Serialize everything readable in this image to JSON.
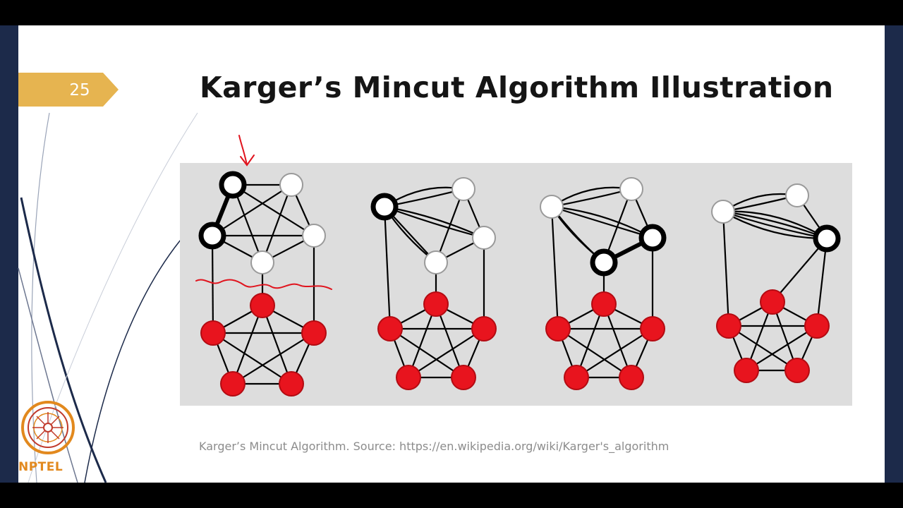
{
  "slide": {
    "number": "25",
    "title": "Karger’s Mincut Algorithm Illustration",
    "caption": "Karger’s Mincut Algorithm. Source: https://en.wikipedia.org/wiki/Karger's_algorithm"
  },
  "logo": {
    "text": "NPTEL"
  },
  "colors": {
    "frame": "#000000",
    "slide_border": "#1c2a4a",
    "slide_bg": "#ffffff",
    "number_tab": "#e6b450",
    "figure_bg": "#dddddd",
    "red_node": "#e8141e",
    "white_node": "#ffffff",
    "black_node": "#000000",
    "annotation": "#e0141e"
  },
  "diagram": {
    "panels": [
      {
        "name": "step-1",
        "nodes": [
          {
            "id": "a",
            "kind": "black"
          },
          {
            "id": "b",
            "kind": "white"
          },
          {
            "id": "c",
            "kind": "black"
          },
          {
            "id": "d",
            "kind": "white"
          },
          {
            "id": "e",
            "kind": "white"
          },
          {
            "id": "r1",
            "kind": "red"
          },
          {
            "id": "r2",
            "kind": "red"
          },
          {
            "id": "r3",
            "kind": "red"
          },
          {
            "id": "r4",
            "kind": "red"
          },
          {
            "id": "r5",
            "kind": "red"
          }
        ],
        "contract_edge": [
          "a",
          "c"
        ]
      },
      {
        "name": "step-2",
        "nodes": [
          {
            "id": "a",
            "kind": "black"
          },
          {
            "id": "b",
            "kind": "white"
          },
          {
            "id": "d",
            "kind": "white"
          },
          {
            "id": "e",
            "kind": "white"
          },
          {
            "id": "r1",
            "kind": "red"
          },
          {
            "id": "r2",
            "kind": "red"
          },
          {
            "id": "r3",
            "kind": "red"
          },
          {
            "id": "r4",
            "kind": "red"
          },
          {
            "id": "r5",
            "kind": "red"
          }
        ]
      },
      {
        "name": "step-3",
        "nodes": [
          {
            "id": "a",
            "kind": "white"
          },
          {
            "id": "b",
            "kind": "white"
          },
          {
            "id": "d",
            "kind": "black"
          },
          {
            "id": "e",
            "kind": "black"
          },
          {
            "id": "r1",
            "kind": "red"
          },
          {
            "id": "r2",
            "kind": "red"
          },
          {
            "id": "r3",
            "kind": "red"
          },
          {
            "id": "r4",
            "kind": "red"
          },
          {
            "id": "r5",
            "kind": "red"
          }
        ],
        "contract_edge": [
          "d",
          "e"
        ]
      },
      {
        "name": "step-4",
        "nodes": [
          {
            "id": "a",
            "kind": "white"
          },
          {
            "id": "b",
            "kind": "white"
          },
          {
            "id": "d",
            "kind": "black"
          },
          {
            "id": "r1",
            "kind": "red"
          },
          {
            "id": "r2",
            "kind": "red"
          },
          {
            "id": "r3",
            "kind": "red"
          },
          {
            "id": "r4",
            "kind": "red"
          },
          {
            "id": "r5",
            "kind": "red"
          }
        ]
      }
    ]
  },
  "icons": [
    "nptel-logo-icon",
    "annotation-arrow-icon",
    "annotation-underline-icon"
  ]
}
